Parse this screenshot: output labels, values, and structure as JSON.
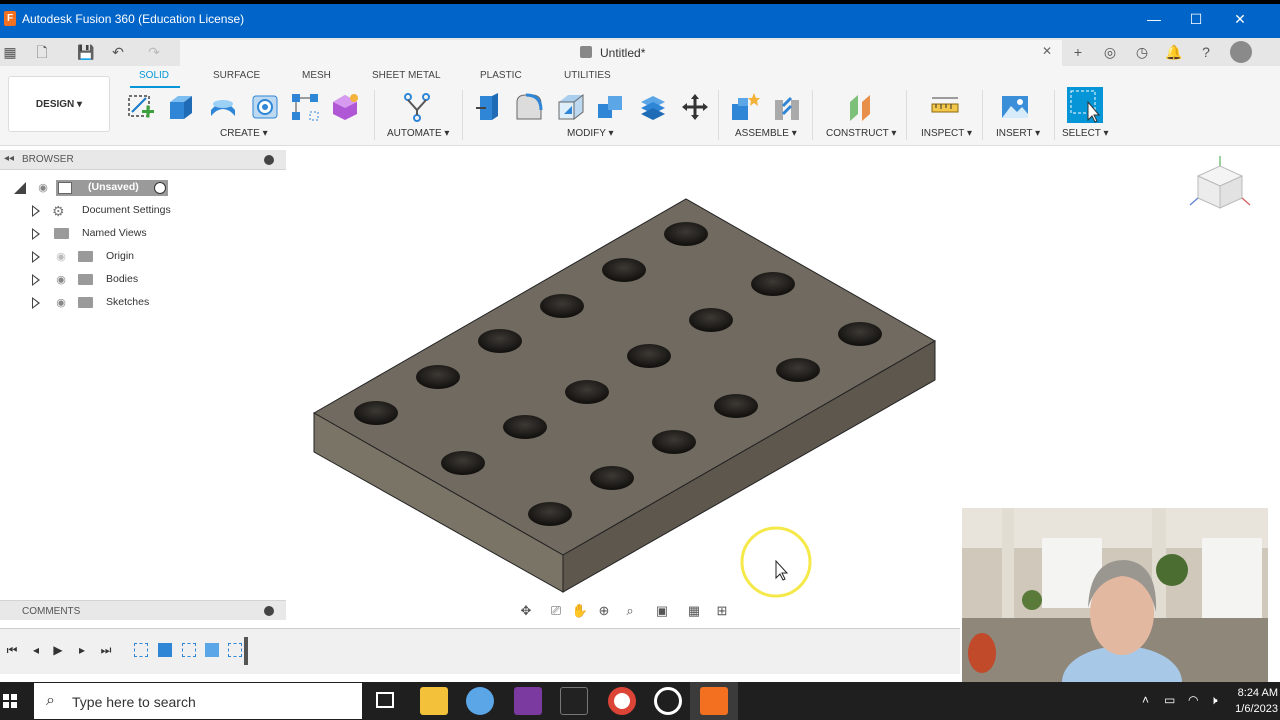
{
  "window": {
    "title": "Autodesk Fusion 360 (Education License)",
    "doc_tab": "Untitled*"
  },
  "ribbon": {
    "workspace": "DESIGN ▾",
    "tabs": [
      "SOLID",
      "SURFACE",
      "MESH",
      "SHEET METAL",
      "PLASTIC",
      "UTILITIES"
    ],
    "groups": [
      "CREATE ▾",
      "AUTOMATE ▾",
      "MODIFY ▾",
      "ASSEMBLE ▾",
      "CONSTRUCT ▾",
      "INSPECT ▾",
      "INSERT ▾",
      "SELECT ▾"
    ]
  },
  "browser": {
    "header": "BROWSER",
    "root": "(Unsaved)",
    "items": [
      "Document Settings",
      "Named Views",
      "Origin",
      "Bodies",
      "Sketches"
    ]
  },
  "comments": {
    "header": "COMMENTS"
  },
  "taskbar": {
    "search_placeholder": "Type here to search",
    "time": "8:24 AM",
    "date": "1/6/2023"
  }
}
